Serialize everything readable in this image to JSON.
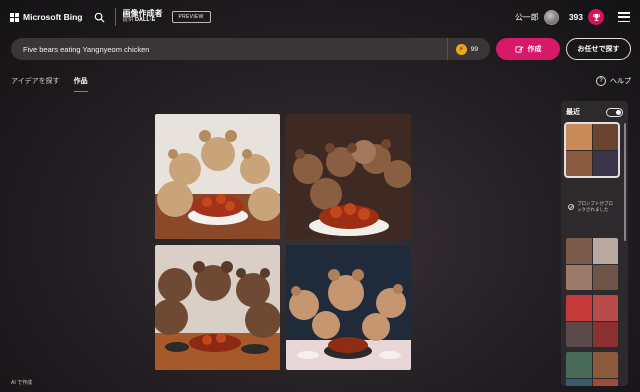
{
  "header": {
    "brand": "Microsoft Bing",
    "app_title": "画像作成者",
    "powered_by_prefix": "提供",
    "powered_by_name": "DALL·E",
    "preview_badge": "PREVIEW",
    "username": "公一郎",
    "points": "393"
  },
  "search": {
    "prompt": "Five bears eating Yangnyeom chicken",
    "boosts": "99",
    "create_label": "作成",
    "surprise_label": "お任せで探す"
  },
  "tabs": [
    {
      "label": "アイデアを探す",
      "active": false
    },
    {
      "label": "作品",
      "active": true
    }
  ],
  "help": {
    "label": "ヘルプ"
  },
  "footer": {
    "text": "AI で作成"
  },
  "recent": {
    "title": "最近",
    "toggle_on": true,
    "blocked_text": "プロンプトがブロックされました"
  },
  "colors": {
    "accent": "#d7196a",
    "panel": "#2c2a2c",
    "searchbar": "#3a3638"
  }
}
